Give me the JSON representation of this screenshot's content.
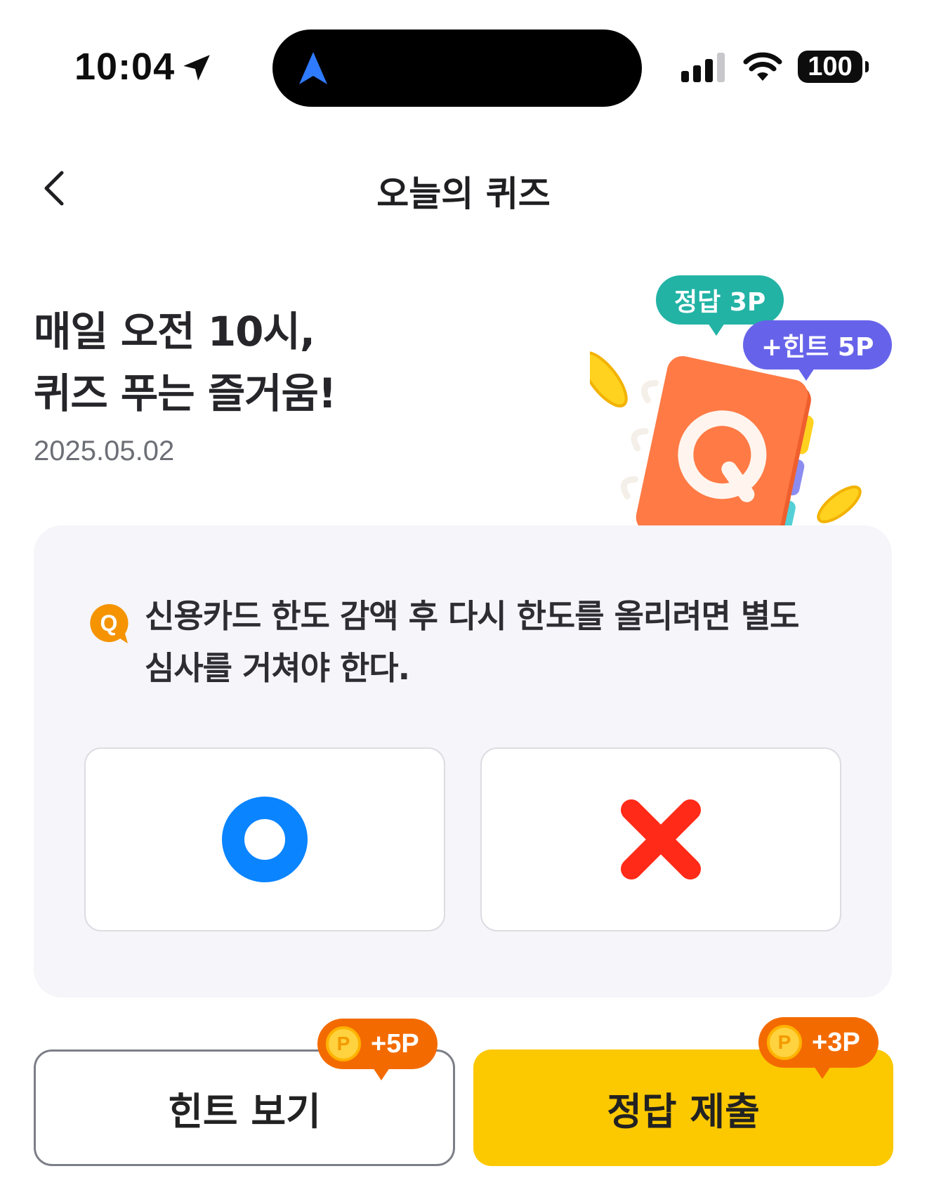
{
  "status_bar": {
    "time": "10:04",
    "battery": "100"
  },
  "header": {
    "title": "오늘의 퀴즈"
  },
  "hero": {
    "title_line1": "매일 오전 10시,",
    "title_line2": "퀴즈 푸는 즐거움!",
    "date": "2025.05.02",
    "badge_answer": "정답 3P",
    "badge_hint": "+힌트 5P"
  },
  "quiz": {
    "question_line1": "신용카드 한도 감액 후 다시 한도를 올리려면 별도",
    "question_line2": "심사를 거쳐야 한다.",
    "q_label": "Q"
  },
  "actions": {
    "hint_label": "힌트 보기",
    "hint_points": "+5P",
    "submit_label": "정답 제출",
    "submit_points": "+3P",
    "coin_symbol": "P"
  },
  "colors": {
    "accent_yellow": "#fcc800",
    "o_blue": "#0a84ff",
    "x_red": "#ff2a17",
    "points_orange": "#f36b00"
  }
}
